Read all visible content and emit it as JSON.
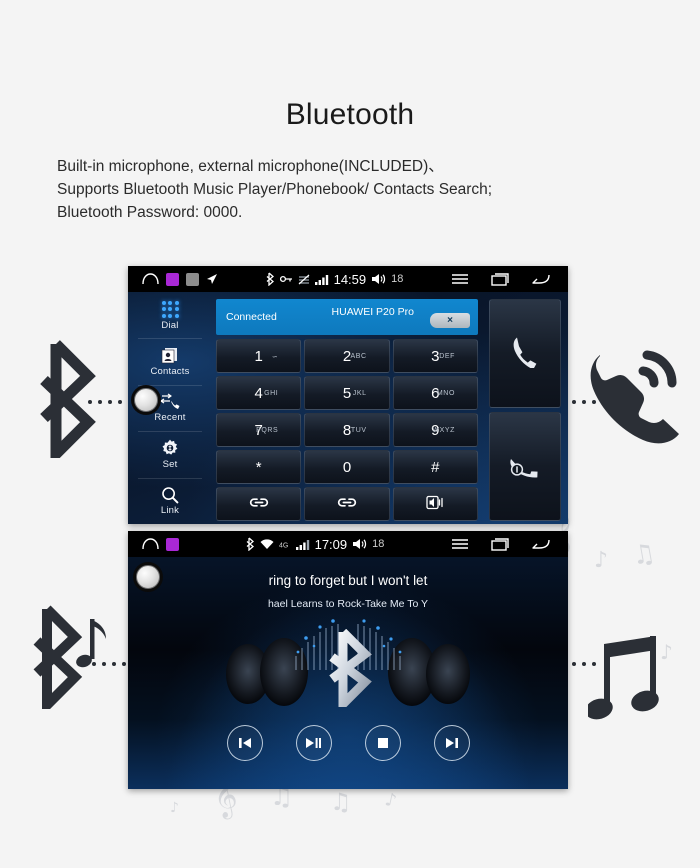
{
  "page": {
    "title": "Bluetooth",
    "description": [
      "Built-in microphone, external microphone(INCLUDED)、",
      "Supports Bluetooth Music Player/Phonebook/ Contacts Search;",
      "Bluetooth Password: 0000."
    ],
    "background_color": "#f4f4f4"
  },
  "dialer_screen": {
    "statusbar": {
      "time": "14:59",
      "volume": "18",
      "icons_left": [
        "home-icon",
        "app-icon-purple",
        "app-icon-grey",
        "navigation-icon"
      ],
      "icons_center": [
        "bluetooth-icon",
        "key-icon",
        "no-sim-icon",
        "signal-icon",
        "speaker-icon"
      ],
      "icons_right": [
        "menu-icon",
        "recents-icon",
        "back-icon"
      ]
    },
    "sidebar": [
      {
        "label": "Dial",
        "icon": "keypad-dots-icon",
        "active": true
      },
      {
        "label": "Contacts",
        "icon": "contacts-icon",
        "active": false
      },
      {
        "label": "Recent",
        "icon": "recent-calls-icon",
        "active": false
      },
      {
        "label": "Set",
        "icon": "gear-icon",
        "active": false
      },
      {
        "label": "Link",
        "icon": "search-icon",
        "active": false
      }
    ],
    "connection": {
      "status": "Connected",
      "device": "HUAWEI P20 Pro",
      "disconnect_label": "×",
      "bar_color": "#1187cf"
    },
    "keypad": [
      {
        "num": "1",
        "sub": "∽"
      },
      {
        "num": "2",
        "sub": "ABC"
      },
      {
        "num": "3",
        "sub": "DEF"
      },
      {
        "num": "4",
        "sub": "GHI"
      },
      {
        "num": "5",
        "sub": "JKL"
      },
      {
        "num": "6",
        "sub": "MNO"
      },
      {
        "num": "7",
        "sub": "PQRS"
      },
      {
        "num": "8",
        "sub": "TUV"
      },
      {
        "num": "9",
        "sub": "WXYZ"
      },
      {
        "num": "*",
        "sub": ""
      },
      {
        "num": "0",
        "sub": ""
      },
      {
        "num": "#",
        "sub": ""
      }
    ],
    "keypad_actions": [
      {
        "icon": "link-icon"
      },
      {
        "icon": "link-icon"
      },
      {
        "icon": "transfer-audio-icon"
      }
    ],
    "call_buttons": [
      {
        "icon": "call-answer-icon",
        "name": "answer-call-button"
      },
      {
        "icon": "call-end-icon",
        "name": "end-call-button"
      }
    ]
  },
  "music_screen": {
    "statusbar": {
      "time": "17:09",
      "volume": "18",
      "icons_left": [
        "home-icon",
        "app-icon-purple"
      ],
      "icons_center": [
        "bluetooth-icon",
        "wifi-icon",
        "4g-icon",
        "signal-icon",
        "speaker-icon"
      ],
      "icons_right": [
        "menu-icon",
        "recents-icon",
        "back-icon"
      ]
    },
    "now_playing": {
      "track": "ring to forget but I won't let",
      "artist": "hael Learns to Rock-Take Me To Y"
    },
    "controls": [
      {
        "name": "previous-track-button",
        "icon": "skip-previous-icon",
        "glyph": "⏮"
      },
      {
        "name": "play-pause-button",
        "icon": "play-pause-icon",
        "glyph": "⏯"
      },
      {
        "name": "stop-button",
        "icon": "stop-icon",
        "glyph": "⏹"
      },
      {
        "name": "next-track-button",
        "icon": "skip-next-icon",
        "glyph": "⏭"
      }
    ]
  },
  "decorations": {
    "left_top": "bluetooth-icon",
    "right_top": "phone-ringing-icon",
    "left_bottom": "bluetooth-music-icon",
    "right_bottom": "music-note-icon"
  }
}
